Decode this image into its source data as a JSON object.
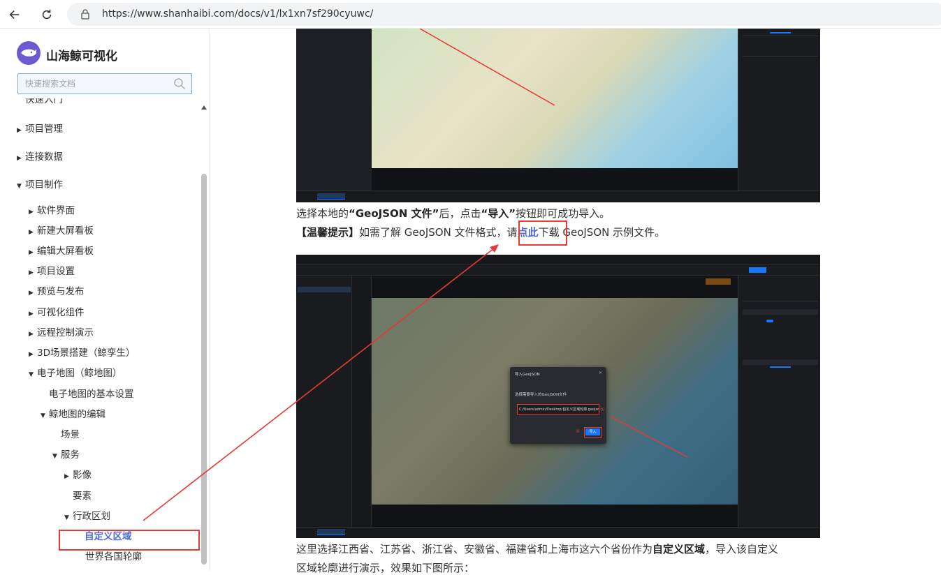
{
  "browser": {
    "url": "https://www.shanhaibi.com/docs/v1/lx1xn7sf290cyuwc/"
  },
  "sidebar": {
    "brand": "山海鲸可视化",
    "search_placeholder": "快速搜索文档",
    "items": [
      {
        "label": "快速入门",
        "level": 0,
        "caret": ""
      },
      {
        "label": "项目管理",
        "level": 0,
        "caret": "▶"
      },
      {
        "label": "连接数据",
        "level": 0,
        "caret": "▶"
      },
      {
        "label": "项目制作",
        "level": 0,
        "caret": "▼"
      },
      {
        "label": "软件界面",
        "level": 1,
        "caret": "▶"
      },
      {
        "label": "新建大屏看板",
        "level": 1,
        "caret": "▶"
      },
      {
        "label": "编辑大屏看板",
        "level": 1,
        "caret": "▶"
      },
      {
        "label": "项目设置",
        "level": 1,
        "caret": "▶"
      },
      {
        "label": "预览与发布",
        "level": 1,
        "caret": "▶"
      },
      {
        "label": "可视化组件",
        "level": 1,
        "caret": "▶"
      },
      {
        "label": "远程控制演示",
        "level": 1,
        "caret": "▶"
      },
      {
        "label": "3D场景搭建（鲸孪生）",
        "level": 1,
        "caret": "▶"
      },
      {
        "label": "电子地图（鲸地图）",
        "level": 1,
        "caret": "▼"
      },
      {
        "label": "电子地图的基本设置",
        "level": 2,
        "caret": ""
      },
      {
        "label": "鲸地图的编辑",
        "level": 2,
        "caret": "▼"
      },
      {
        "label": "场景",
        "level": 3,
        "caret": ""
      },
      {
        "label": "服务",
        "level": 3,
        "caret": "▼"
      },
      {
        "label": "影像",
        "level": 4,
        "caret": "▶"
      },
      {
        "label": "要素",
        "level": 4,
        "caret": ""
      },
      {
        "label": "行政区划",
        "level": 4,
        "caret": "▼"
      },
      {
        "label": "自定义区域",
        "level": 5,
        "caret": "",
        "active": true
      },
      {
        "label": "世界各国轮廓",
        "level": 5,
        "caret": ""
      }
    ]
  },
  "content": {
    "para1_pre": "选择本地的",
    "para1_b1": "“GeoJSON 文件”",
    "para1_mid": "后，点击",
    "para1_b2": "“导入”",
    "para1_post": "按钮即可成功导入。",
    "para2_b": "【温馨提示】",
    "para2_pre": "如需了解 GeoJSON 文件格式，请",
    "para2_link": "点此",
    "para2_post": "下载 GeoJSON 示例文件。",
    "para3_line1_pre": "这里选择江西省、江苏省、浙江省、安徽省、福建省和上海市这六个省份作为",
    "para3_line1_b": "自定义区域",
    "para3_line1_post": "，导入该自定义",
    "para3_line2": "区域轮廓进行演示，效果如下图所示："
  },
  "dialog": {
    "title": "导入GeoJSON",
    "label": "选择需要导入的GeoJSON文件",
    "path": "C:/Users/admin/Desktop/自定义区域轮廓.geojson",
    "button": "导入",
    "marker1": "①",
    "marker2": "②"
  },
  "colors": {
    "highlight": "#e53935",
    "link": "#4f6bd8",
    "brand": "#6b5bd2",
    "primary": "#1677ff"
  }
}
